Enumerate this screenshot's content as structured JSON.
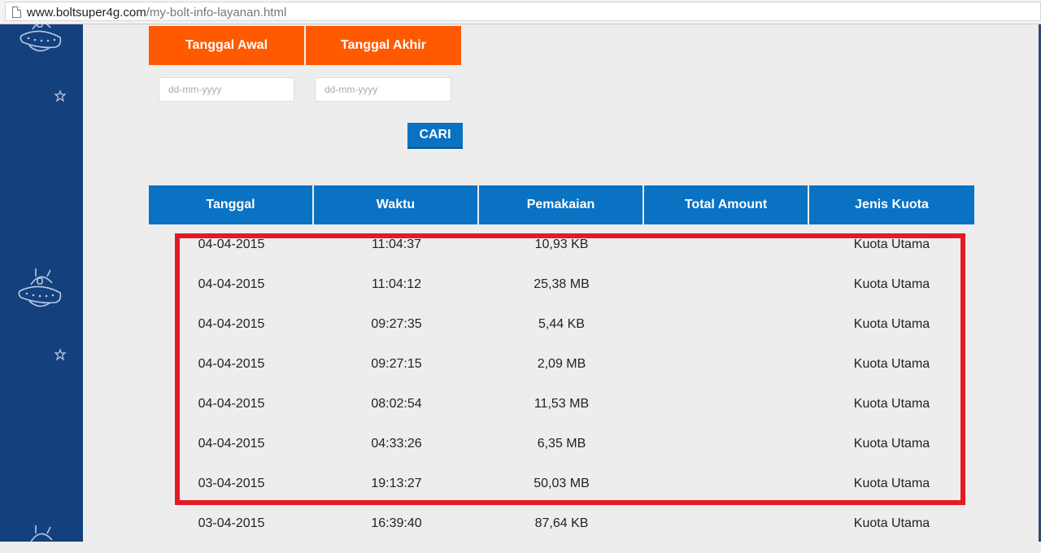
{
  "browser": {
    "url_domain": "www.boltsuper4g.com",
    "url_path": "/my-bolt-info-layanan.html"
  },
  "filter": {
    "start_label": "Tanggal Awal",
    "end_label": "Tanggal Akhir",
    "start_placeholder": "dd-mm-yyyy",
    "end_placeholder": "dd-mm-yyyy",
    "search_label": "CARI"
  },
  "colors": {
    "filter_header": "#ff5a00",
    "table_header": "#0a72c2",
    "sidebar": "#14407e",
    "highlight": "#e21b24"
  },
  "table": {
    "headers": [
      "Tanggal",
      "Waktu",
      "Pemakaian",
      "Total Amount",
      "Jenis Kuota"
    ],
    "rows": [
      [
        "04-04-2015",
        "11:04:37",
        "10,93 KB",
        "",
        "Kuota Utama"
      ],
      [
        "04-04-2015",
        "11:04:12",
        "25,38 MB",
        "",
        "Kuota Utama"
      ],
      [
        "04-04-2015",
        "09:27:35",
        "5,44 KB",
        "",
        "Kuota Utama"
      ],
      [
        "04-04-2015",
        "09:27:15",
        "2,09 MB",
        "",
        "Kuota Utama"
      ],
      [
        "04-04-2015",
        "08:02:54",
        "11,53 MB",
        "",
        "Kuota Utama"
      ],
      [
        "04-04-2015",
        "04:33:26",
        "6,35 MB",
        "",
        "Kuota Utama"
      ],
      [
        "03-04-2015",
        "19:13:27",
        "50,03 MB",
        "",
        "Kuota Utama"
      ],
      [
        "03-04-2015",
        "16:39:40",
        "87,64 KB",
        "",
        "Kuota Utama"
      ]
    ]
  }
}
